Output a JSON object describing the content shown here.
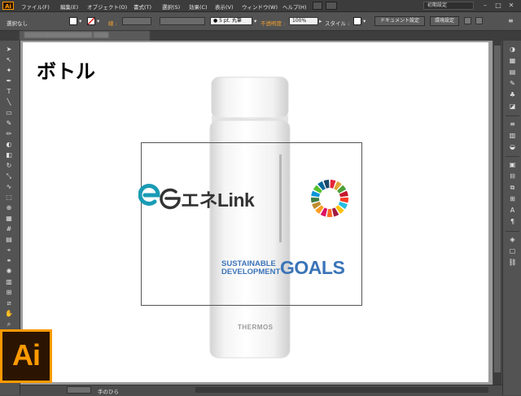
{
  "app": {
    "icon_text": "Ai",
    "logo_text": "Ai"
  },
  "menu": {
    "items": [
      "ファイル(F)",
      "編集(E)",
      "オブジェクト(O)",
      "書式(T)",
      "選択(S)",
      "効果(C)",
      "表示(V)",
      "ウィンドウ(W)",
      "ヘルプ(H)"
    ],
    "workspace": "初期設定"
  },
  "control_bar": {
    "selection": "選択なし",
    "stroke_label": "線 :",
    "brush_value": "● 5 pt. 丸筆",
    "opacity_label": "不透明度 :",
    "opacity_value": "100%",
    "style_label": "スタイル :",
    "doc_settings": "ドキュメント設定",
    "preferences": "環境設定"
  },
  "canvas": {
    "title": "ボトル",
    "enelink_text": "エネLink",
    "sdg_line1": "SUSTAINABLE",
    "sdg_line2": "DEVELOPMENT",
    "sdg_goals": "GOALS",
    "bottle_brand": "THERMOS"
  },
  "status": {
    "tool": "手のひら"
  },
  "colors": {
    "enelink_teal": "#1a9bb5",
    "sdg_blue": "#3b74b8",
    "ai_orange": "#ff9a00",
    "ai_dark": "#2b1502",
    "sdg_wheel": [
      "#e5243b",
      "#dda63a",
      "#4c9f38",
      "#c5192d",
      "#ff3a21",
      "#26bde2",
      "#fcc30b",
      "#a21942",
      "#fd6925",
      "#dd1367",
      "#fd9d24",
      "#bf8b2e",
      "#3f7e44",
      "#0a97d9",
      "#56c02b",
      "#00689d",
      "#19486a"
    ]
  }
}
